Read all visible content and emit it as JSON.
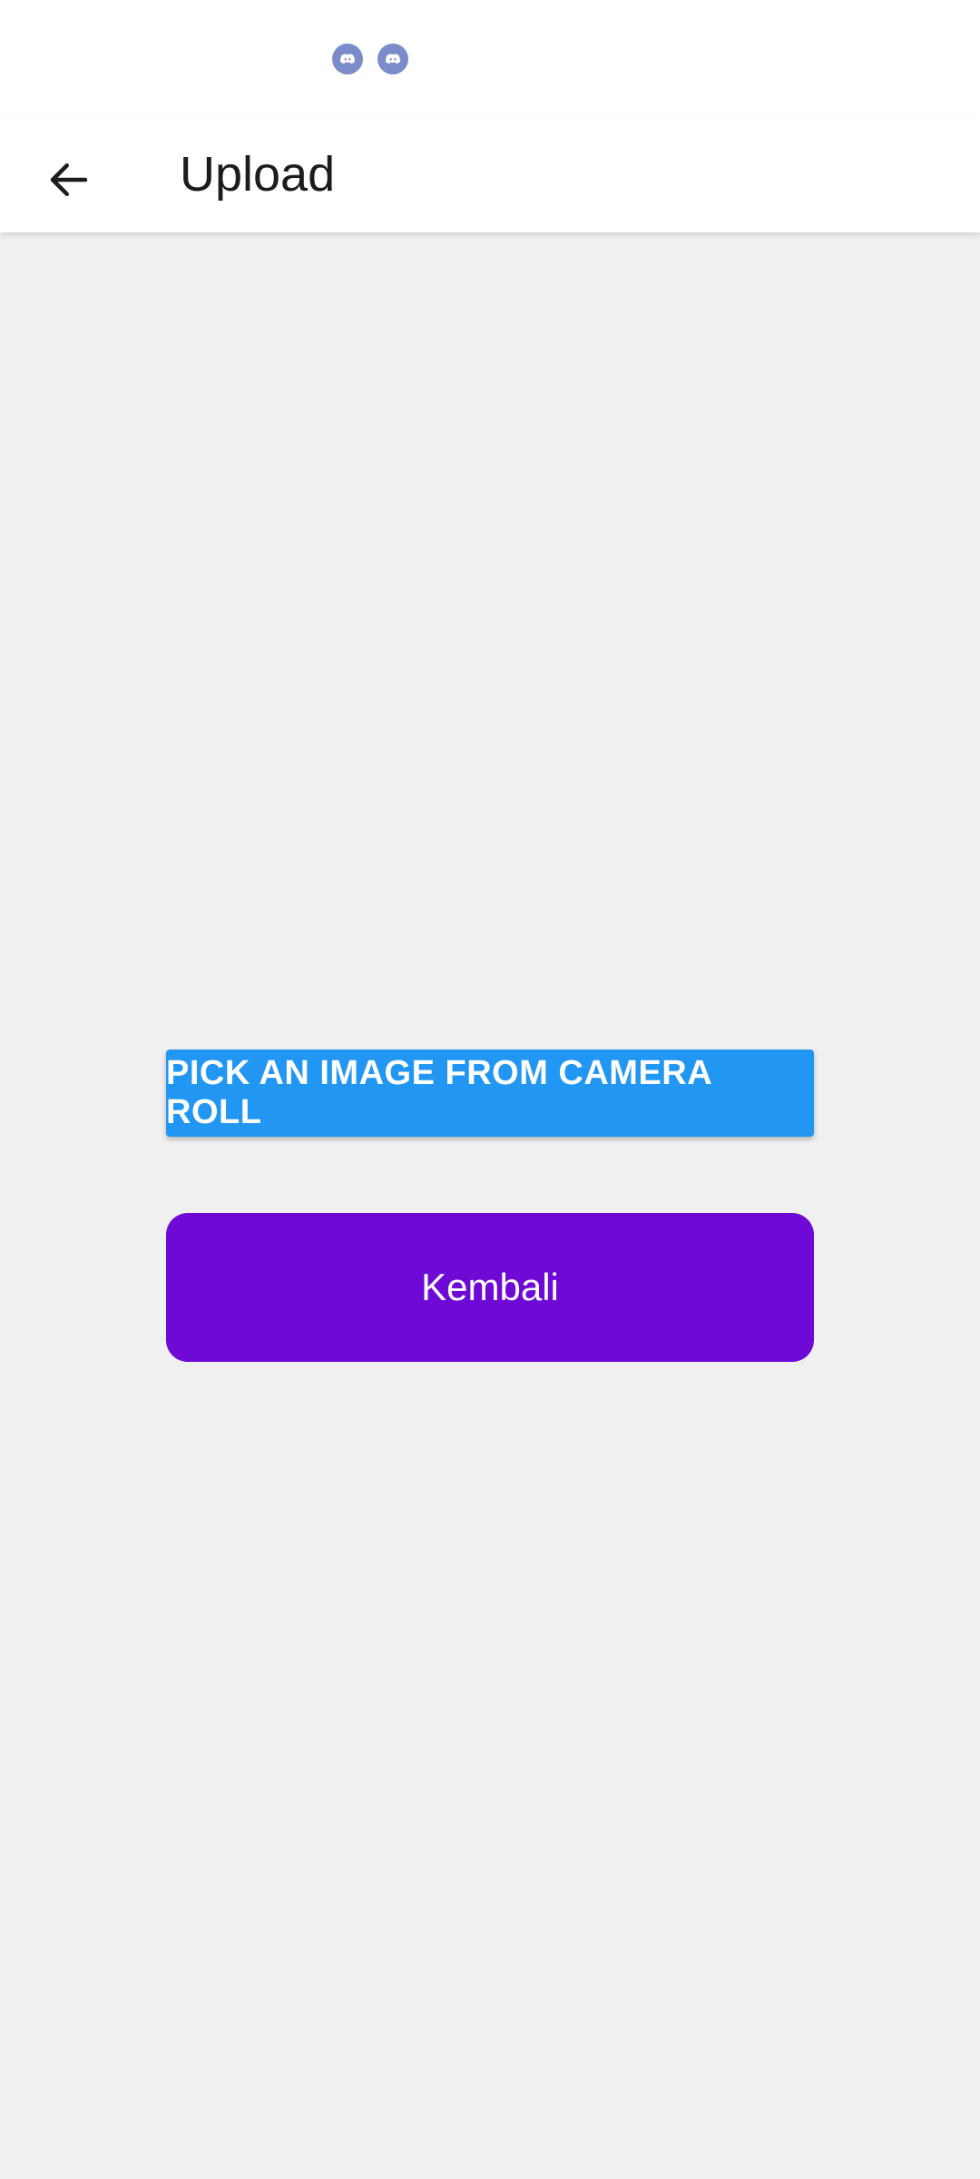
{
  "status_bar": {
    "notification_icons": [
      "discord-icon",
      "discord-icon"
    ],
    "icon_color": "#7a8cc9"
  },
  "app_bar": {
    "back_icon": "arrow-left-icon",
    "title": "Upload"
  },
  "main": {
    "pick_image_label": "PICK AN IMAGE FROM CAMERA ROLL",
    "pick_image_color": "#2196f3",
    "back_label": "Kembali",
    "back_color": "#6e09d6"
  }
}
